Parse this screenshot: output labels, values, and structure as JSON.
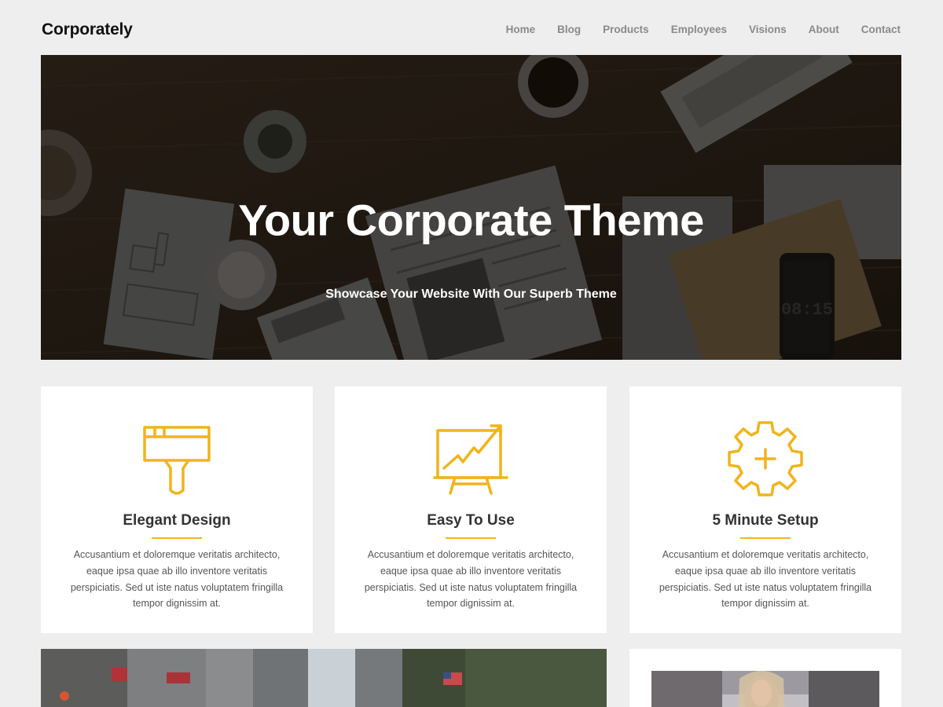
{
  "site": {
    "logo": "Corporately"
  },
  "nav": {
    "items": [
      "Home",
      "Blog",
      "Products",
      "Employees",
      "Visions",
      "About",
      "Contact"
    ]
  },
  "hero": {
    "title": "Your Corporate Theme",
    "subtitle": "Showcase Your Website With Our Superb Theme",
    "clock": "08:15"
  },
  "features": [
    {
      "icon": "paintbrush-icon",
      "title": "Elegant Design",
      "text": "Accusantium et doloremque veritatis architecto, eaque ipsa quae ab illo inventore veritatis perspiciatis. Sed ut iste natus voluptatem fringilla tempor dignissim at."
    },
    {
      "icon": "chart-board-icon",
      "title": "Easy To Use",
      "text": "Accusantium et doloremque veritatis architecto, eaque ipsa quae ab illo inventore veritatis perspiciatis. Sed ut iste natus voluptatem fringilla tempor dignissim at."
    },
    {
      "icon": "gear-plus-icon",
      "title": "5 Minute Setup",
      "text": "Accusantium et doloremque veritatis architecto, eaque ipsa quae ab illo inventore veritatis perspiciatis. Sed ut iste natus voluptatem fringilla tempor dignissim at."
    }
  ],
  "colors": {
    "accent": "#f0b41c",
    "background": "#eeeeee"
  }
}
